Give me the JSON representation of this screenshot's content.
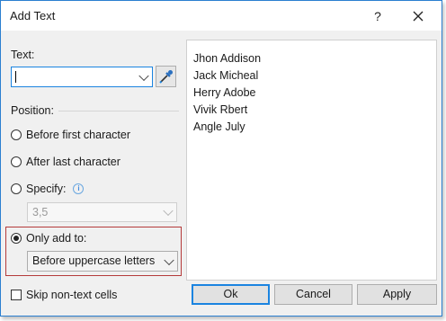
{
  "window": {
    "title": "Add Text",
    "help_label": "?"
  },
  "text_section": {
    "label": "Text:",
    "value": ""
  },
  "position": {
    "label": "Position:",
    "options": [
      {
        "label": "Before first character",
        "selected": false
      },
      {
        "label": "After last character",
        "selected": false
      },
      {
        "label": "Specify:",
        "selected": false
      },
      {
        "label": "Only add to:",
        "selected": true
      }
    ],
    "specify_value": "3,5",
    "only_add_to_value": "Before uppercase letters"
  },
  "skip_non_text_label": "Skip non-text cells",
  "preview_items": [
    "Jhon Addison",
    "Jack Micheal",
    "Herry Adobe",
    "Vivik Rbert",
    "Angle July"
  ],
  "buttons": {
    "ok": "Ok",
    "cancel": "Cancel",
    "apply": "Apply"
  },
  "colors": {
    "accent": "#1b84e0",
    "highlight_border": "#b43a3a"
  }
}
